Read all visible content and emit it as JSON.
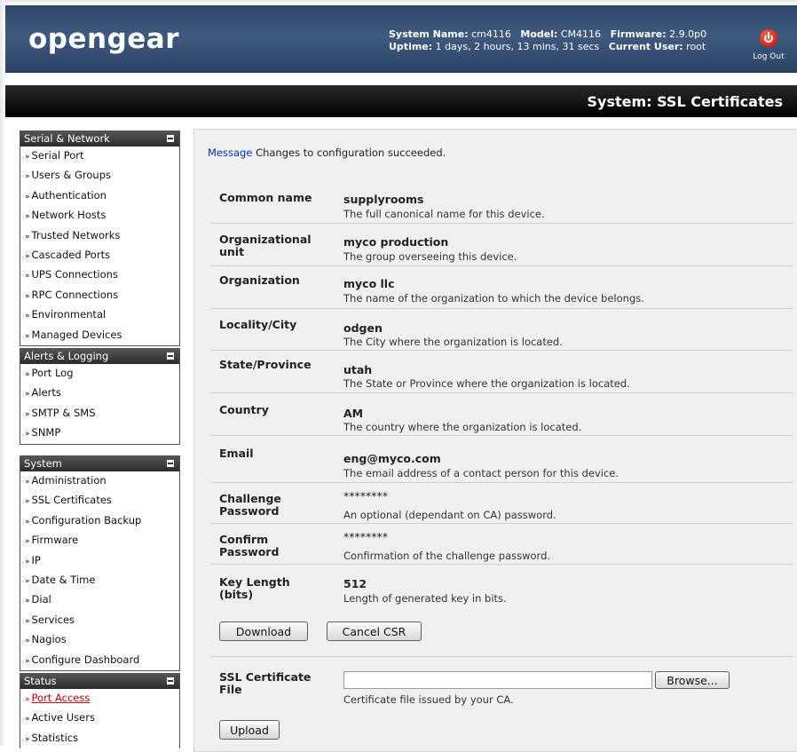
{
  "header": {
    "logo_text": "opengear",
    "system_name_label": "System Name:",
    "system_name": "cm4116",
    "model_label": "Model:",
    "model": "CM4116",
    "firmware_label": "Firmware:",
    "firmware": "2.9.0p0",
    "uptime_label": "Uptime:",
    "uptime": "1 days, 2 hours, 13 mins, 31 secs",
    "current_user_label": "Current User:",
    "current_user": "root",
    "logout_label": "Log Out",
    "logout_icon": "power-icon"
  },
  "page_title": "System: SSL Certificates",
  "sidebar": {
    "serial_network": {
      "title": "Serial & Network",
      "items": [
        "Serial Port",
        "Users & Groups",
        "Authentication",
        "Network Hosts",
        "Trusted Networks",
        "Cascaded Ports",
        "UPS Connections",
        "RPC Connections",
        "Environmental",
        "Managed Devices"
      ]
    },
    "alerts_logging": {
      "title": "Alerts & Logging",
      "items": [
        "Port Log",
        "Alerts",
        "SMTP & SMS",
        "SNMP"
      ]
    },
    "system": {
      "title": "System",
      "items": [
        "Administration",
        "SSL Certificates",
        "Configuration Backup",
        "Firmware",
        "IP",
        "Date & Time",
        "Dial",
        "Services",
        "Nagios",
        "Configure Dashboard"
      ]
    },
    "status": {
      "title": "Status",
      "items": [
        "Port Access",
        "Active Users",
        "Statistics"
      ],
      "active_item": "Port Access"
    },
    "bullet": "»"
  },
  "message": {
    "label": "Message",
    "text": "Changes to configuration succeeded."
  },
  "fields": {
    "common_name": {
      "label": "Common name",
      "value": "supplyrooms",
      "desc": "The full canonical name for this device."
    },
    "org_unit": {
      "label1": "Organizational",
      "label2": "unit",
      "value": "myco production",
      "desc": "The group overseeing this device."
    },
    "organization": {
      "label": "Organization",
      "value": "myco llc",
      "desc": "The name of the organization to which the device belongs."
    },
    "locality": {
      "label": "Locality/City",
      "value": "odgen",
      "desc": "The City where the organization is located."
    },
    "state": {
      "label": "State/Province",
      "value": "utah",
      "desc": "The State or Province where the organization is located."
    },
    "country": {
      "label": "Country",
      "value": "AM",
      "desc": "The country where the organization is located."
    },
    "email": {
      "label": "Email",
      "value": "eng@myco.com",
      "desc": "The email address of a contact person for this device."
    },
    "challenge": {
      "label1": "Challenge",
      "label2": "Password",
      "value": "********",
      "desc": "An optional (dependant on CA) password."
    },
    "confirm": {
      "label1": "Confirm",
      "label2": "Password",
      "value": "********",
      "desc": "Confirmation of the challenge password."
    },
    "key_length": {
      "label1": "Key Length",
      "label2": "(bits)",
      "value": "512",
      "desc": "Length of generated key in bits."
    }
  },
  "buttons": {
    "download": "Download",
    "cancel_csr": "Cancel CSR",
    "browse": "Browse...",
    "upload": "Upload"
  },
  "ssl_file": {
    "label1": "SSL Certificate",
    "label2": "File",
    "value": "",
    "desc": "Certificate file issued by your CA."
  }
}
